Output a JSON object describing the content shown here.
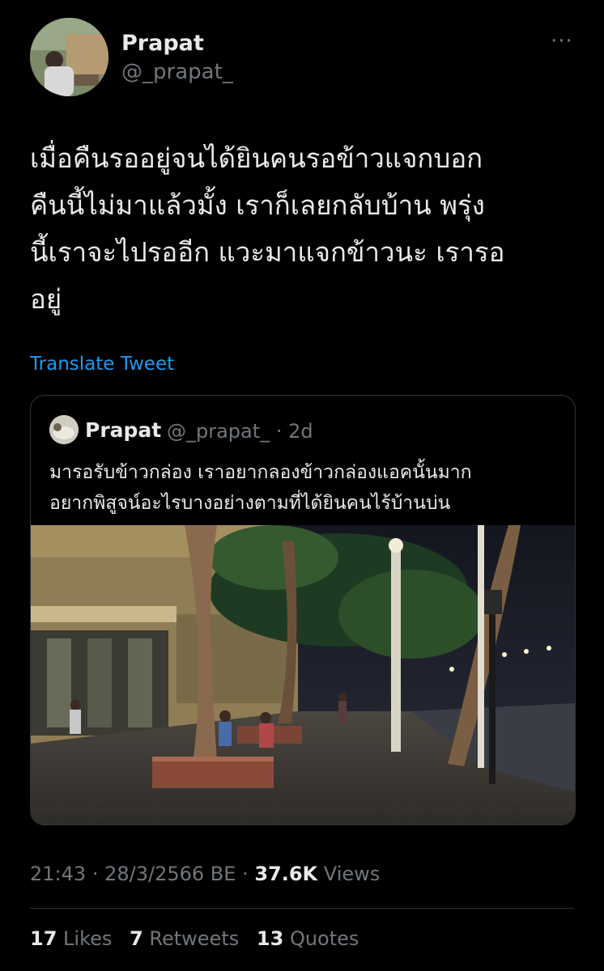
{
  "author": {
    "name": "Prapat",
    "handle": "@_prapat_"
  },
  "tweet": {
    "text": "เมื่อคืนรออยู่จนได้ยินคนรอข้าวแจกบอก\nคืนนี้ไม่มาแล้วมั้ง เราก็เลยกลับบ้าน พรุ่ง\nนี้เราจะไปรออีก แวะมาแจกข้าวนะ เรารอ\nอยู่",
    "translate_label": "Translate Tweet",
    "more_icon": "···"
  },
  "quoted": {
    "name": "Prapat",
    "handle": "@_prapat_",
    "separator": "·",
    "age": "2d",
    "text": "มารอรับข้าวกล่อง เราอยากลองข้าวกล่องแอคนั้นมาก\nอยากพิสูจน์อะไรบางอย่างตามที่ได้ยินคนไร้บ้านบ่น"
  },
  "meta": {
    "time": "21:43",
    "sep1": "·",
    "date": "28/3/2566 BE",
    "sep2": "·",
    "views_count": "37.6K",
    "views_label": "Views"
  },
  "stats": {
    "likes_count": "17",
    "likes_label": "Likes",
    "retweets_count": "7",
    "retweets_label": "Retweets",
    "quotes_count": "13",
    "quotes_label": "Quotes"
  },
  "colors": {
    "background": "#000000",
    "link": "#1d9bf0",
    "secondary_text": "#71767b",
    "border": "#2f3336"
  }
}
